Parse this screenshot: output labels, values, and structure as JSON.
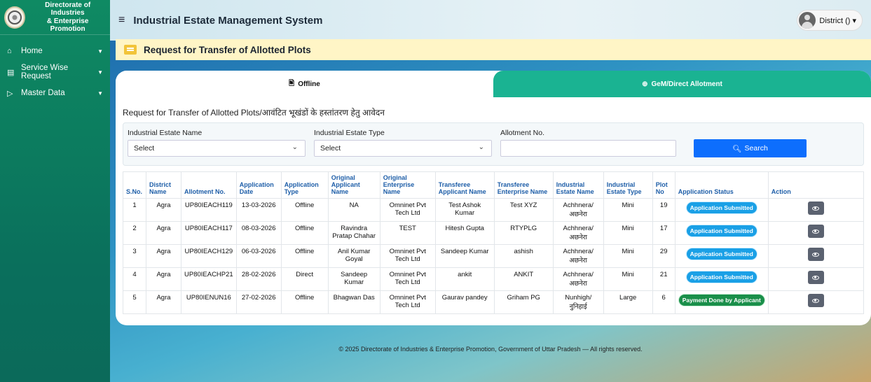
{
  "brand": {
    "line1": "Directorate of Industries",
    "line2": "& Enterprise Promotion"
  },
  "sidebar": {
    "items": [
      {
        "label": "Home",
        "icon": "home-icon",
        "glyph": "⌂"
      },
      {
        "label": "Service Wise Request",
        "icon": "request-icon",
        "glyph": "▤"
      },
      {
        "label": "Master Data",
        "icon": "master-data-icon",
        "glyph": "▷"
      }
    ]
  },
  "header": {
    "menu_glyph": "≡",
    "title": "Industrial Estate Management System",
    "user": "District () ▾"
  },
  "page": {
    "title": "Request for Transfer of Allotted Plots"
  },
  "tabs": [
    {
      "label": "Offline",
      "glyph": "🖹"
    },
    {
      "label": "GeM/Direct Allotment",
      "glyph": "⊕"
    }
  ],
  "form": {
    "title": "Request for Transfer of Allotted Plots/आवंटित भूखंडों के हस्तांतरण हेतु आवेदन",
    "estate_name_label": "Industrial Estate Name",
    "estate_name_value": "Select",
    "estate_type_label": "Industrial Estate Type",
    "estate_type_value": "Select",
    "allotment_label": "Allotment No.",
    "allotment_value": "",
    "search_label": "Search",
    "search_glyph": "🔍︎"
  },
  "table": {
    "headers": [
      "S.No.",
      "District Name",
      "Allotment No.",
      "Application Date",
      "Application Type",
      "Original Applicant Name",
      "Original Enterprise Name",
      "Transferee Applicant Name",
      "Transferee Enterprise Name",
      "Industrial Estate Name",
      "Industrial Estate Type",
      "Plot No",
      "Application Status",
      "Action"
    ],
    "rows": [
      [
        "1",
        "Agra",
        "UP80IEACH119",
        "13-03-2026",
        "Offline",
        "NA",
        "Omninet Pvt Tech Ltd",
        "Test Ashok Kumar",
        "Test XYZ",
        "Achhnera/ अछनेरा",
        "Mini",
        "19",
        "Application Submitted"
      ],
      [
        "2",
        "Agra",
        "UP80IEACH117",
        "08-03-2026",
        "Offline",
        "Ravindra Pratap Chahar",
        "TEST",
        "Hitesh Gupta",
        "RTYPLG",
        "Achhnera/ अछनेरा",
        "Mini",
        "17",
        "Application Submitted"
      ],
      [
        "3",
        "Agra",
        "UP80IEACH129",
        "06-03-2026",
        "Offline",
        "Anil Kumar Goyal",
        "Omninet Pvt Tech Ltd",
        "Sandeep Kumar",
        "ashish",
        "Achhnera/ अछनेरा",
        "Mini",
        "29",
        "Application Submitted"
      ],
      [
        "4",
        "Agra",
        "UP80IEACHP21",
        "28-02-2026",
        "Direct",
        "Sandeep Kumar",
        "Omninet Pvt Tech Ltd",
        "ankit",
        "ANKIT",
        "Achhnera/ अछनेरा",
        "Mini",
        "21",
        "Application Submitted"
      ],
      [
        "5",
        "Agra",
        "UP80IENUN16",
        "27-02-2026",
        "Offline",
        "Bhagwan Das",
        "Omninet Pvt Tech Ltd",
        "Gaurav pandey",
        "Griham PG",
        "Nunhigh/नुनिहाई",
        "Large",
        "6",
        "Payment Done by Applicant"
      ]
    ]
  },
  "colors": {
    "status_submitted": "#1aa0e6",
    "status_paid": "#1a8f4a",
    "tab_inactive": "#1ab392",
    "search": "#0d6efd"
  },
  "footer": "© 2025 Directorate of Industries & Enterprise Promotion, Government of Uttar Pradesh — All rights reserved."
}
